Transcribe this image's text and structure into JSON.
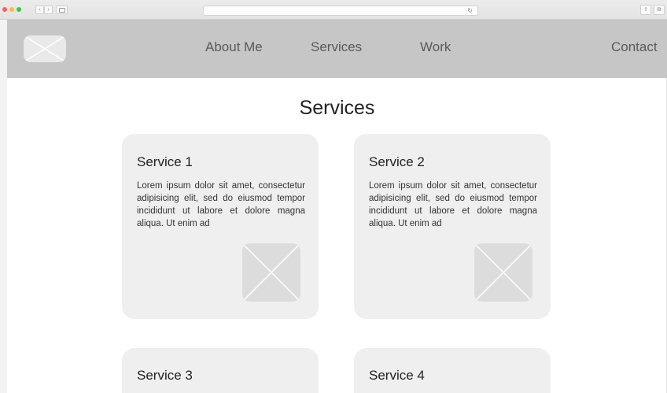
{
  "browser": {
    "reload_glyph": "↻",
    "back_glyph": "‹",
    "forward_glyph": "›",
    "share_glyph": "⇪",
    "tabs_glyph": "⧉"
  },
  "header": {
    "logo_icon": "image-placeholder-icon",
    "nav": {
      "about": "About Me",
      "services": "Services",
      "work": "Work",
      "contact": "Contact"
    }
  },
  "main": {
    "title": "Services",
    "cards": [
      {
        "title": "Service 1",
        "text": "Lorem ipsum dolor sit amet, consectetur adipisicing elit, sed do eiusmod tempor incididunt ut labore et dolore magna aliqua. Ut enim ad",
        "image_icon": "image-placeholder-icon"
      },
      {
        "title": "Service 2",
        "text": "Lorem ipsum dolor sit amet, consectetur adipisicing elit, sed do eiusmod tempor incididunt ut labore et dolore magna aliqua. Ut enim ad",
        "image_icon": "image-placeholder-icon"
      },
      {
        "title": "Service 3"
      },
      {
        "title": "Service 4"
      }
    ]
  },
  "colors": {
    "header_bg": "#c6c6c6",
    "card_bg": "#efefef",
    "placeholder_bg": "#dcdcdc"
  }
}
